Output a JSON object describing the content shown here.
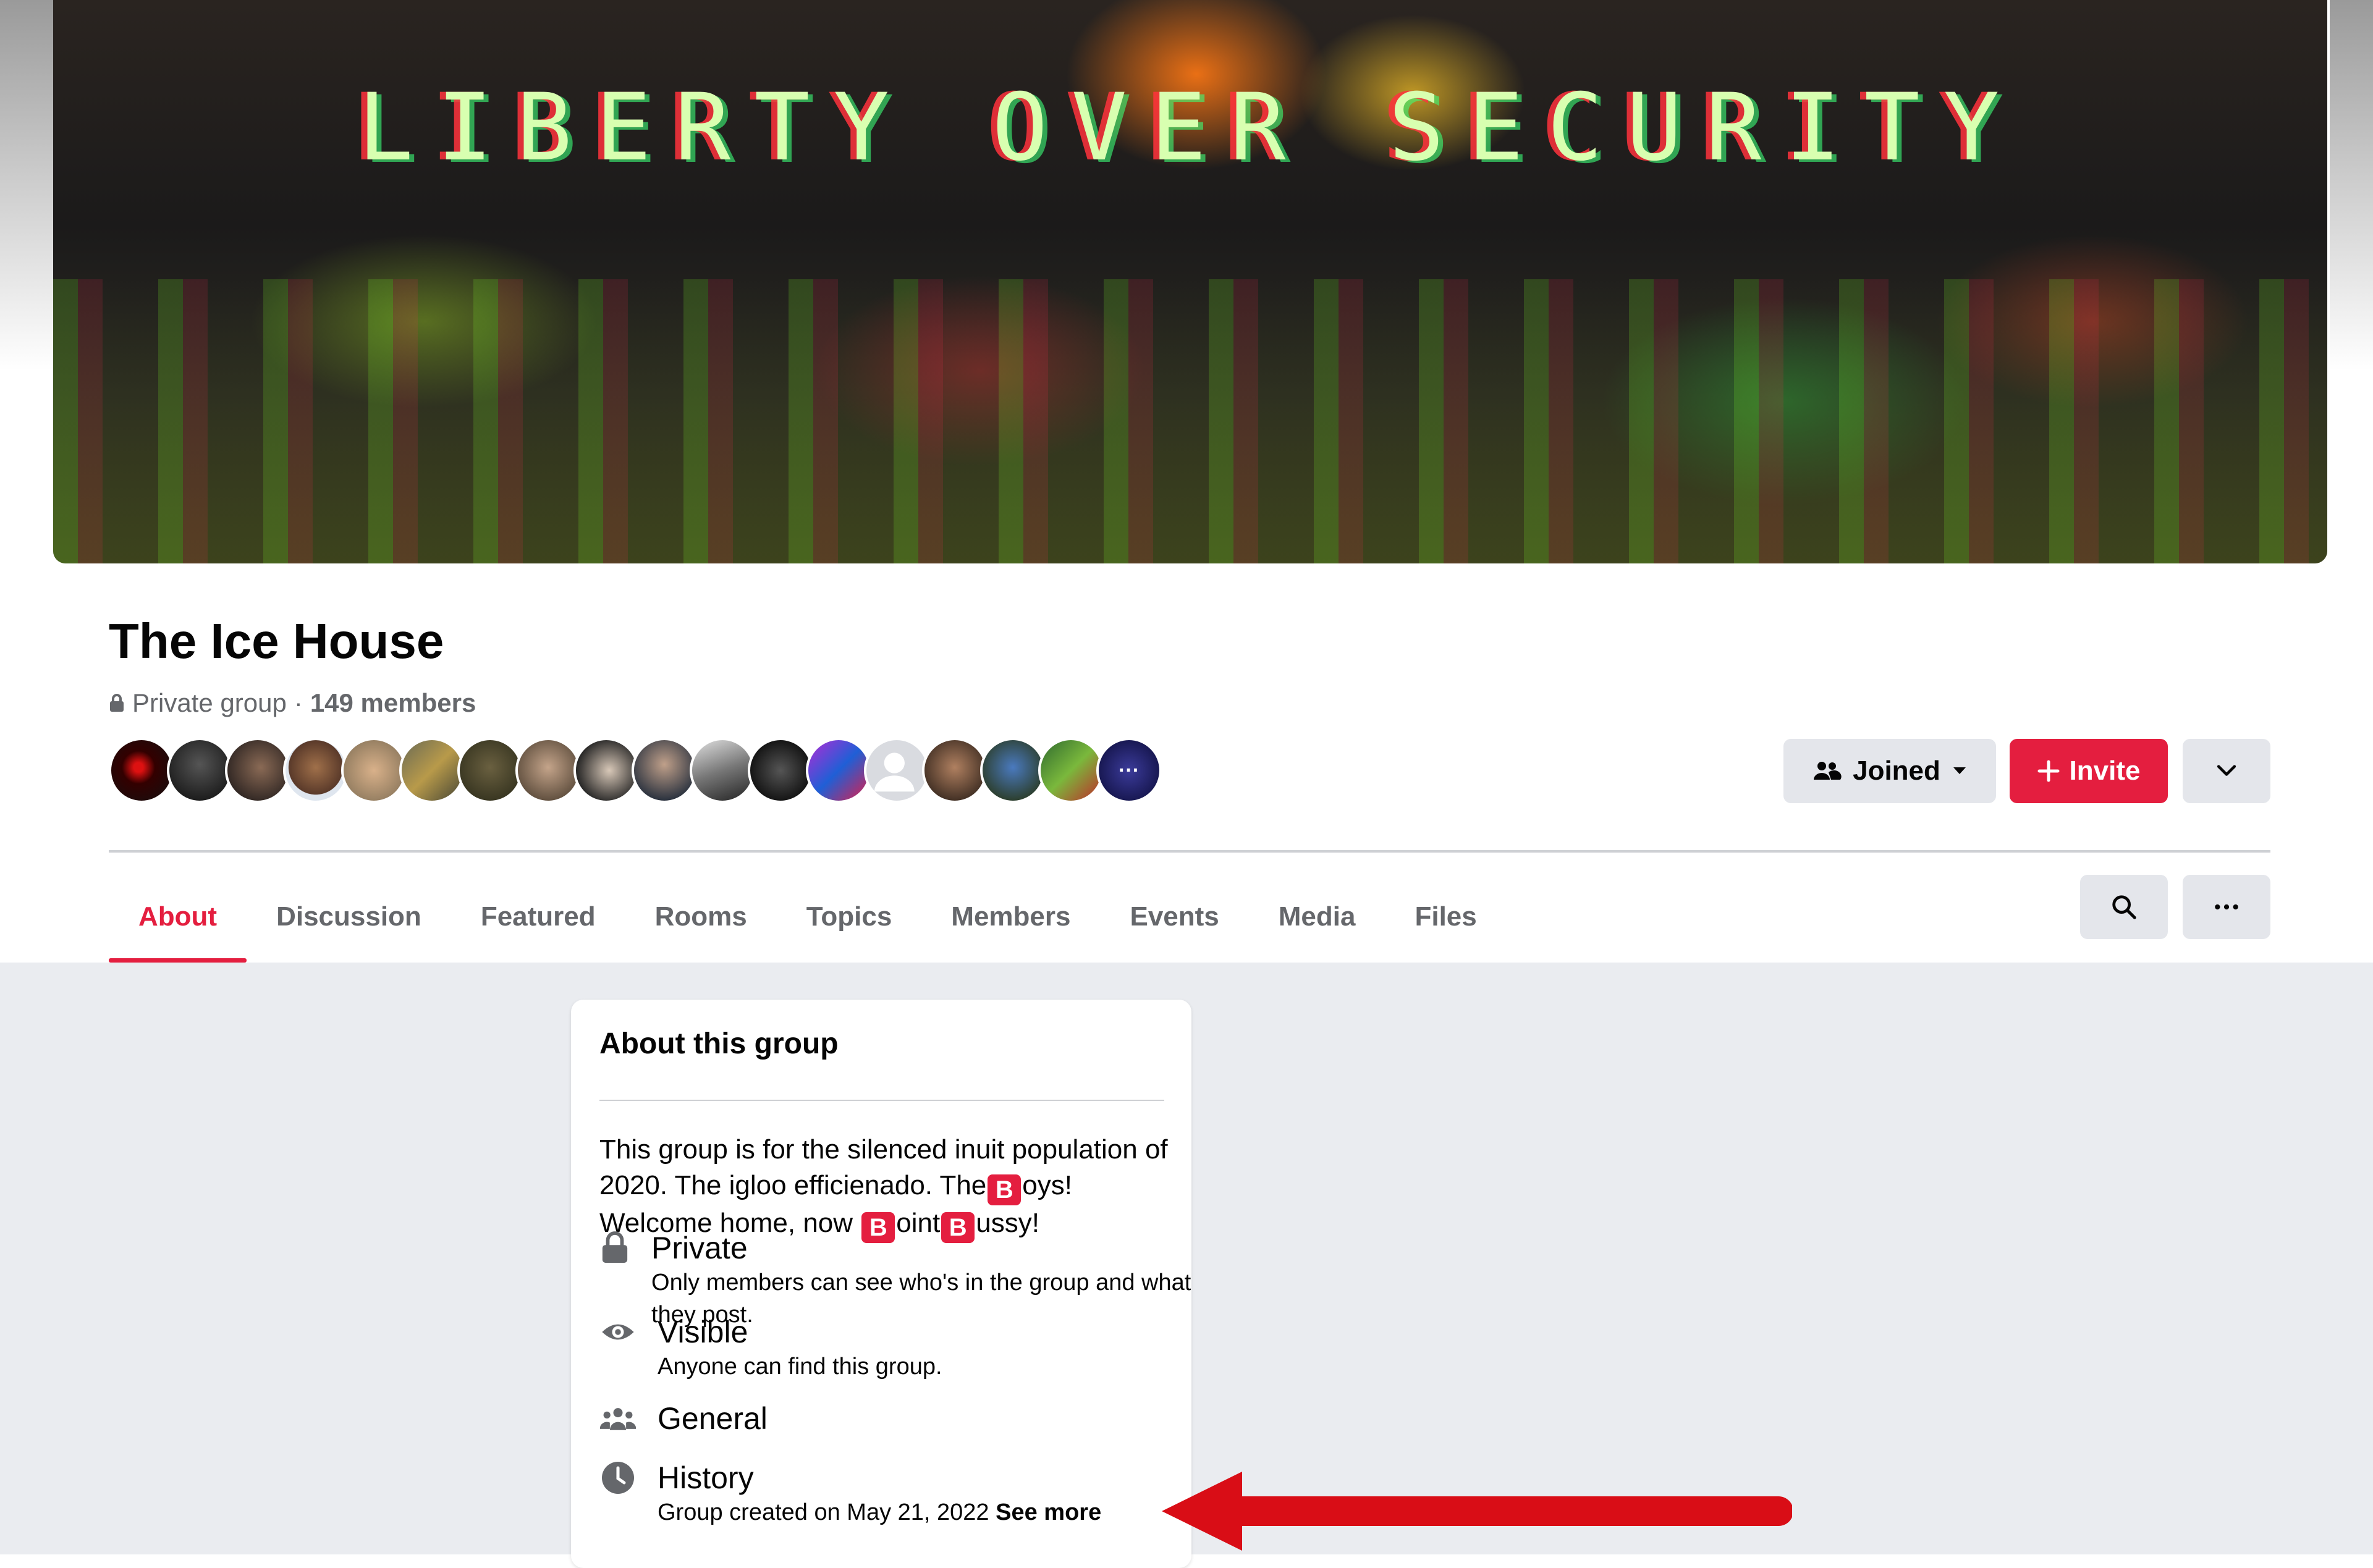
{
  "cover": {
    "text": "LIBERTY OVER SECURITY"
  },
  "group": {
    "name": "The Ice House",
    "privacy": "Private group",
    "separator": "·",
    "members": "149 members",
    "avatar_more": "···"
  },
  "actions": {
    "joined_label": "Joined",
    "invite_label": "Invite"
  },
  "tabs": [
    {
      "label": "About",
      "active": true
    },
    {
      "label": "Discussion"
    },
    {
      "label": "Featured"
    },
    {
      "label": "Rooms"
    },
    {
      "label": "Topics"
    },
    {
      "label": "Members"
    },
    {
      "label": "Events"
    },
    {
      "label": "Media"
    },
    {
      "label": "Files"
    }
  ],
  "about": {
    "title": "About this group",
    "desc_part1": "This group is for the silenced inuit population of 2020. The igloo efficienado. The",
    "desc_part2": "oys! Welcome home, now ",
    "desc_part3": "oint",
    "desc_part4": "ussy!",
    "b_emoji": "B",
    "rows": {
      "private": {
        "label": "Private",
        "sub": "Only members can see who's in the group and what they post."
      },
      "visible": {
        "label": "Visible",
        "sub": "Anyone can find this group."
      },
      "general": {
        "label": "General"
      },
      "history": {
        "label": "History",
        "sub": "Group created on May 21, 2022",
        "see_more": "See more"
      }
    }
  },
  "colors": {
    "accent": "#e41e3f",
    "secondary_text": "#65676b",
    "page_bg": "#eaecf0",
    "button_grey": "#e4e6eb"
  }
}
